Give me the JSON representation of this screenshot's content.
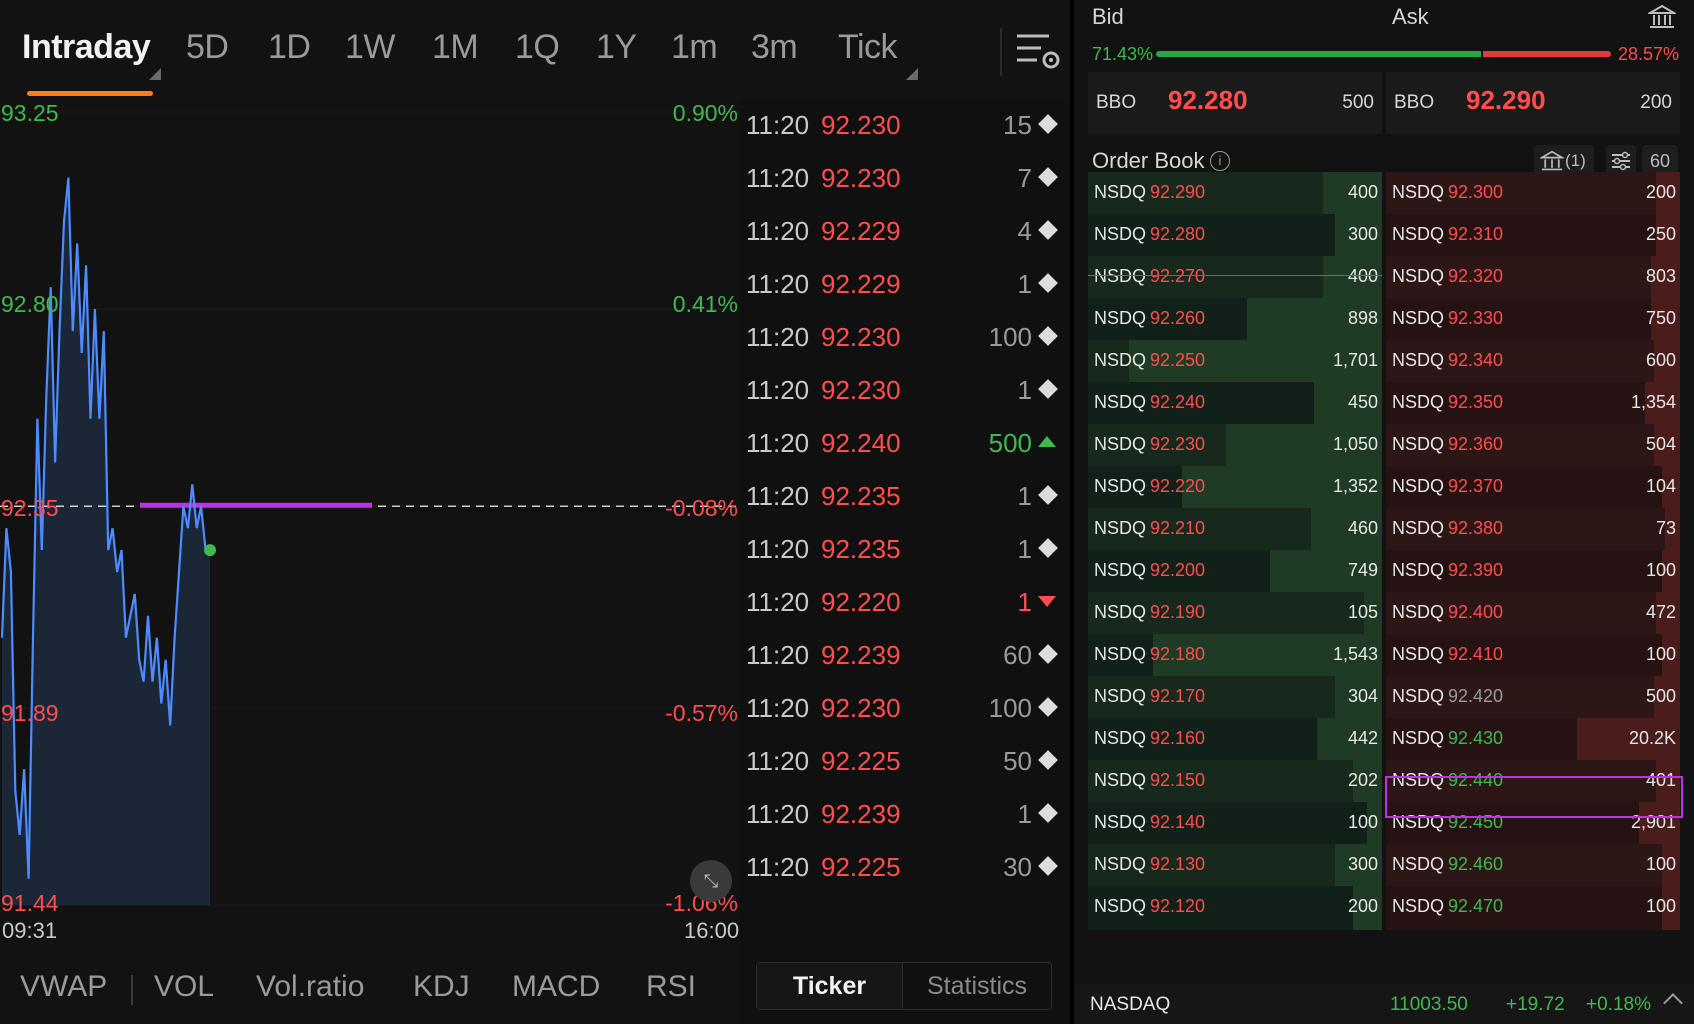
{
  "tabs": {
    "items": [
      "Intraday",
      "5D",
      "1D",
      "1W",
      "1M",
      "1Q",
      "1Y",
      "1m",
      "3m",
      "Tick"
    ],
    "active": "Intraday"
  },
  "chart": {
    "y_left": [
      "93.25",
      "92.80",
      "92.35",
      "91.89",
      "91.44"
    ],
    "y_right": [
      "0.90%",
      "0.41%",
      "-0.08%",
      "-0.57%",
      "-1.06%"
    ],
    "time_start": "09:31",
    "time_end": "16:00",
    "colors": {
      "line": "#4d8cff",
      "reference_line": "#c030e8",
      "up": "#3fb950",
      "down": "#ff4d4d"
    }
  },
  "chart_data": {
    "type": "line",
    "series": [
      {
        "values": [
          92.05,
          92.3,
          92.2,
          91.7,
          91.6,
          91.75,
          91.5,
          92.05,
          92.55,
          92.25,
          92.6,
          92.85,
          92.45,
          92.75,
          93.0,
          93.1,
          92.75,
          92.95,
          92.7,
          92.9,
          92.55,
          92.8,
          92.55,
          92.75,
          92.25,
          92.3,
          92.2,
          92.25,
          92.05,
          92.1,
          92.15,
          92.0,
          91.95,
          92.1,
          91.95,
          92.05,
          91.9,
          92.0,
          91.85,
          92.05,
          92.2,
          92.35,
          92.3,
          92.4,
          92.3,
          92.35,
          92.25,
          92.25
        ]
      }
    ],
    "ylim": [
      91.44,
      93.25
    ],
    "reference_price": 92.35,
    "highlight_level": 92.35,
    "grid": true
  },
  "indicators": [
    "VWAP",
    "VOL",
    "Vol.ratio",
    "KDJ",
    "MACD",
    "RSI"
  ],
  "ticker": {
    "rows": [
      {
        "time": "11:20",
        "price": "92.230",
        "size": "15",
        "dir": "neutral"
      },
      {
        "time": "11:20",
        "price": "92.230",
        "size": "7",
        "dir": "neutral"
      },
      {
        "time": "11:20",
        "price": "92.229",
        "size": "4",
        "dir": "neutral"
      },
      {
        "time": "11:20",
        "price": "92.229",
        "size": "1",
        "dir": "neutral"
      },
      {
        "time": "11:20",
        "price": "92.230",
        "size": "100",
        "dir": "neutral"
      },
      {
        "time": "11:20",
        "price": "92.230",
        "size": "1",
        "dir": "neutral"
      },
      {
        "time": "11:20",
        "price": "92.240",
        "size": "500",
        "dir": "up"
      },
      {
        "time": "11:20",
        "price": "92.235",
        "size": "1",
        "dir": "neutral"
      },
      {
        "time": "11:20",
        "price": "92.235",
        "size": "1",
        "dir": "neutral"
      },
      {
        "time": "11:20",
        "price": "92.220",
        "size": "1",
        "dir": "down"
      },
      {
        "time": "11:20",
        "price": "92.239",
        "size": "60",
        "dir": "neutral"
      },
      {
        "time": "11:20",
        "price": "92.230",
        "size": "100",
        "dir": "neutral"
      },
      {
        "time": "11:20",
        "price": "92.225",
        "size": "50",
        "dir": "neutral"
      },
      {
        "time": "11:20",
        "price": "92.239",
        "size": "1",
        "dir": "neutral"
      },
      {
        "time": "11:20",
        "price": "92.225",
        "size": "30",
        "dir": "neutral"
      }
    ],
    "tab_active": "Ticker",
    "tab_other": "Statistics"
  },
  "book": {
    "bid_label": "Bid",
    "ask_label": "Ask",
    "bid_pct": "71.43%",
    "ask_pct": "28.57%",
    "bid_ratio": 0.7143,
    "bbo_tag": "BBO",
    "bbo_bid_price": "92.280",
    "bbo_bid_size": "500",
    "bbo_ask_price": "92.290",
    "bbo_ask_size": "200",
    "title": "Order Book",
    "bank_btn_label": "(1)",
    "depth_label": "60",
    "bids": [
      {
        "venue": "NSDQ",
        "price": "92.290",
        "size": "400",
        "fill": 0.2
      },
      {
        "venue": "NSDQ",
        "price": "92.280",
        "size": "300",
        "fill": 0.16
      },
      {
        "venue": "NSDQ",
        "price": "92.270",
        "size": "400",
        "fill": 0.2
      },
      {
        "venue": "NSDQ",
        "price": "92.260",
        "size": "898",
        "fill": 0.46
      },
      {
        "venue": "NSDQ",
        "price": "92.250",
        "size": "1,701",
        "fill": 0.86
      },
      {
        "venue": "NSDQ",
        "price": "92.240",
        "size": "450",
        "fill": 0.23
      },
      {
        "venue": "NSDQ",
        "price": "92.230",
        "size": "1,050",
        "fill": 0.53
      },
      {
        "venue": "NSDQ",
        "price": "92.220",
        "size": "1,352",
        "fill": 0.68
      },
      {
        "venue": "NSDQ",
        "price": "92.210",
        "size": "460",
        "fill": 0.24
      },
      {
        "venue": "NSDQ",
        "price": "92.200",
        "size": "749",
        "fill": 0.38
      },
      {
        "venue": "NSDQ",
        "price": "92.190",
        "size": "105",
        "fill": 0.06
      },
      {
        "venue": "NSDQ",
        "price": "92.180",
        "size": "1,543",
        "fill": 0.78
      },
      {
        "venue": "NSDQ",
        "price": "92.170",
        "size": "304",
        "fill": 0.16
      },
      {
        "venue": "NSDQ",
        "price": "92.160",
        "size": "442",
        "fill": 0.22
      },
      {
        "venue": "NSDQ",
        "price": "92.150",
        "size": "202",
        "fill": 0.1
      },
      {
        "venue": "NSDQ",
        "price": "92.140",
        "size": "100",
        "fill": 0.05
      },
      {
        "venue": "NSDQ",
        "price": "92.130",
        "size": "300",
        "fill": 0.16
      },
      {
        "venue": "NSDQ",
        "price": "92.120",
        "size": "200",
        "fill": 0.1
      }
    ],
    "asks": [
      {
        "venue": "NSDQ",
        "price": "92.300",
        "size": "200",
        "fill": 0.08,
        "price_color": "#ff4d4d"
      },
      {
        "venue": "NSDQ",
        "price": "92.310",
        "size": "250",
        "fill": 0.08,
        "price_color": "#ff4d4d"
      },
      {
        "venue": "NSDQ",
        "price": "92.320",
        "size": "803",
        "fill": 0.1,
        "price_color": "#ff4d4d"
      },
      {
        "venue": "NSDQ",
        "price": "92.330",
        "size": "750",
        "fill": 0.1,
        "price_color": "#ff4d4d"
      },
      {
        "venue": "NSDQ",
        "price": "92.340",
        "size": "600",
        "fill": 0.09,
        "price_color": "#ff4d4d"
      },
      {
        "venue": "NSDQ",
        "price": "92.350",
        "size": "1,354",
        "fill": 0.12,
        "price_color": "#ff4d4d"
      },
      {
        "venue": "NSDQ",
        "price": "92.360",
        "size": "504",
        "fill": 0.09,
        "price_color": "#ff4d4d"
      },
      {
        "venue": "NSDQ",
        "price": "92.370",
        "size": "104",
        "fill": 0.06,
        "price_color": "#ff4d4d"
      },
      {
        "venue": "NSDQ",
        "price": "92.380",
        "size": "73",
        "fill": 0.05,
        "price_color": "#ff4d4d"
      },
      {
        "venue": "NSDQ",
        "price": "92.390",
        "size": "100",
        "fill": 0.06,
        "price_color": "#ff4d4d"
      },
      {
        "venue": "NSDQ",
        "price": "92.400",
        "size": "472",
        "fill": 0.08,
        "price_color": "#ff4d4d"
      },
      {
        "venue": "NSDQ",
        "price": "92.410",
        "size": "100",
        "fill": 0.06,
        "price_color": "#ff4d4d"
      },
      {
        "venue": "NSDQ",
        "price": "92.420",
        "size": "500",
        "fill": 0.09,
        "price_color": "#9a9a9a"
      },
      {
        "venue": "NSDQ",
        "price": "92.430",
        "size": "20.2K",
        "fill": 0.35,
        "price_color": "#3fb950"
      },
      {
        "venue": "NSDQ",
        "price": "92.440",
        "size": "401",
        "fill": 0.08,
        "price_color": "#3fb950"
      },
      {
        "venue": "NSDQ",
        "price": "92.450",
        "size": "2,901",
        "fill": 0.14,
        "price_color": "#3fb950"
      },
      {
        "venue": "NSDQ",
        "price": "92.460",
        "size": "100",
        "fill": 0.06,
        "price_color": "#3fb950"
      },
      {
        "venue": "NSDQ",
        "price": "92.470",
        "size": "100",
        "fill": 0.06,
        "price_color": "#3fb950"
      }
    ]
  },
  "footer": {
    "name": "NASDAQ",
    "value": "11003.50",
    "change": "+19.72",
    "pct": "+0.18%"
  }
}
